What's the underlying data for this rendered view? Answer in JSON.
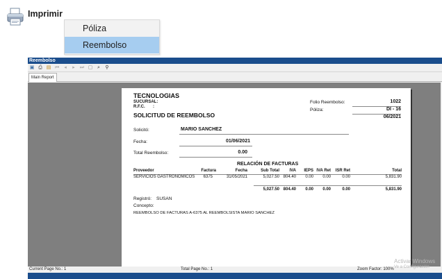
{
  "toolbar_top": {
    "print_label": "Imprimir"
  },
  "menu": {
    "items": [
      "Póliza",
      "Reembolso"
    ]
  },
  "window": {
    "title": "Reembolso",
    "tab": "Main Report",
    "status": {
      "current_page": "Current Page No.: 1",
      "total_page": "Total Page No.: 1",
      "zoom": "Zoom Factor: 100%"
    }
  },
  "report": {
    "company": "TECNOLOGIAS",
    "sucursal_label": "SUCURSAL:",
    "rfc_label": "R.F.C.",
    "rfc_sep": ":",
    "doc_title": "SOLICITUD DE REEMBOLSO",
    "folio_label": "Folio Reembolso:",
    "folio_value": "1022",
    "poliza_label": "Póliza:",
    "poliza_value": "DI - 16",
    "period": "06/2021",
    "solicito_label": "Solicitó:",
    "solicito_value": "MARIO SANCHEZ",
    "fecha_label": "Fecha:",
    "fecha_value": "01/06/2021",
    "total_label": "Total Reembolso:",
    "total_value": "0.00",
    "section_title": "RELACIÓN DE FACTURAS",
    "columns": [
      "Proveedor",
      "Factura",
      "Fecha",
      "Sub Total",
      "IVA",
      "IEPS",
      "IVA Ret",
      "ISR Ret",
      "Total"
    ],
    "rows": [
      [
        "SERVICIOS GASTRONOMICOS",
        "6375",
        "31/05/2021",
        "5,027.50",
        "804.40",
        "0.00",
        "0.00",
        "0.00",
        "5,831.90"
      ]
    ],
    "totals": [
      "5,027.50",
      "804.40",
      "0.00",
      "0.00",
      "0.00",
      "5,831.90"
    ],
    "registro_label": "Registró:",
    "registro_value": "SUSAN",
    "concepto_label": "Concepto:",
    "concepto_value": "REEMBOLSO DE FACTURAS A-6375 AL REEMBOLSISTA MARIO SANCHEZ"
  },
  "watermark": {
    "line1": "Activar Windows",
    "line2": "Ve a Configuración"
  }
}
